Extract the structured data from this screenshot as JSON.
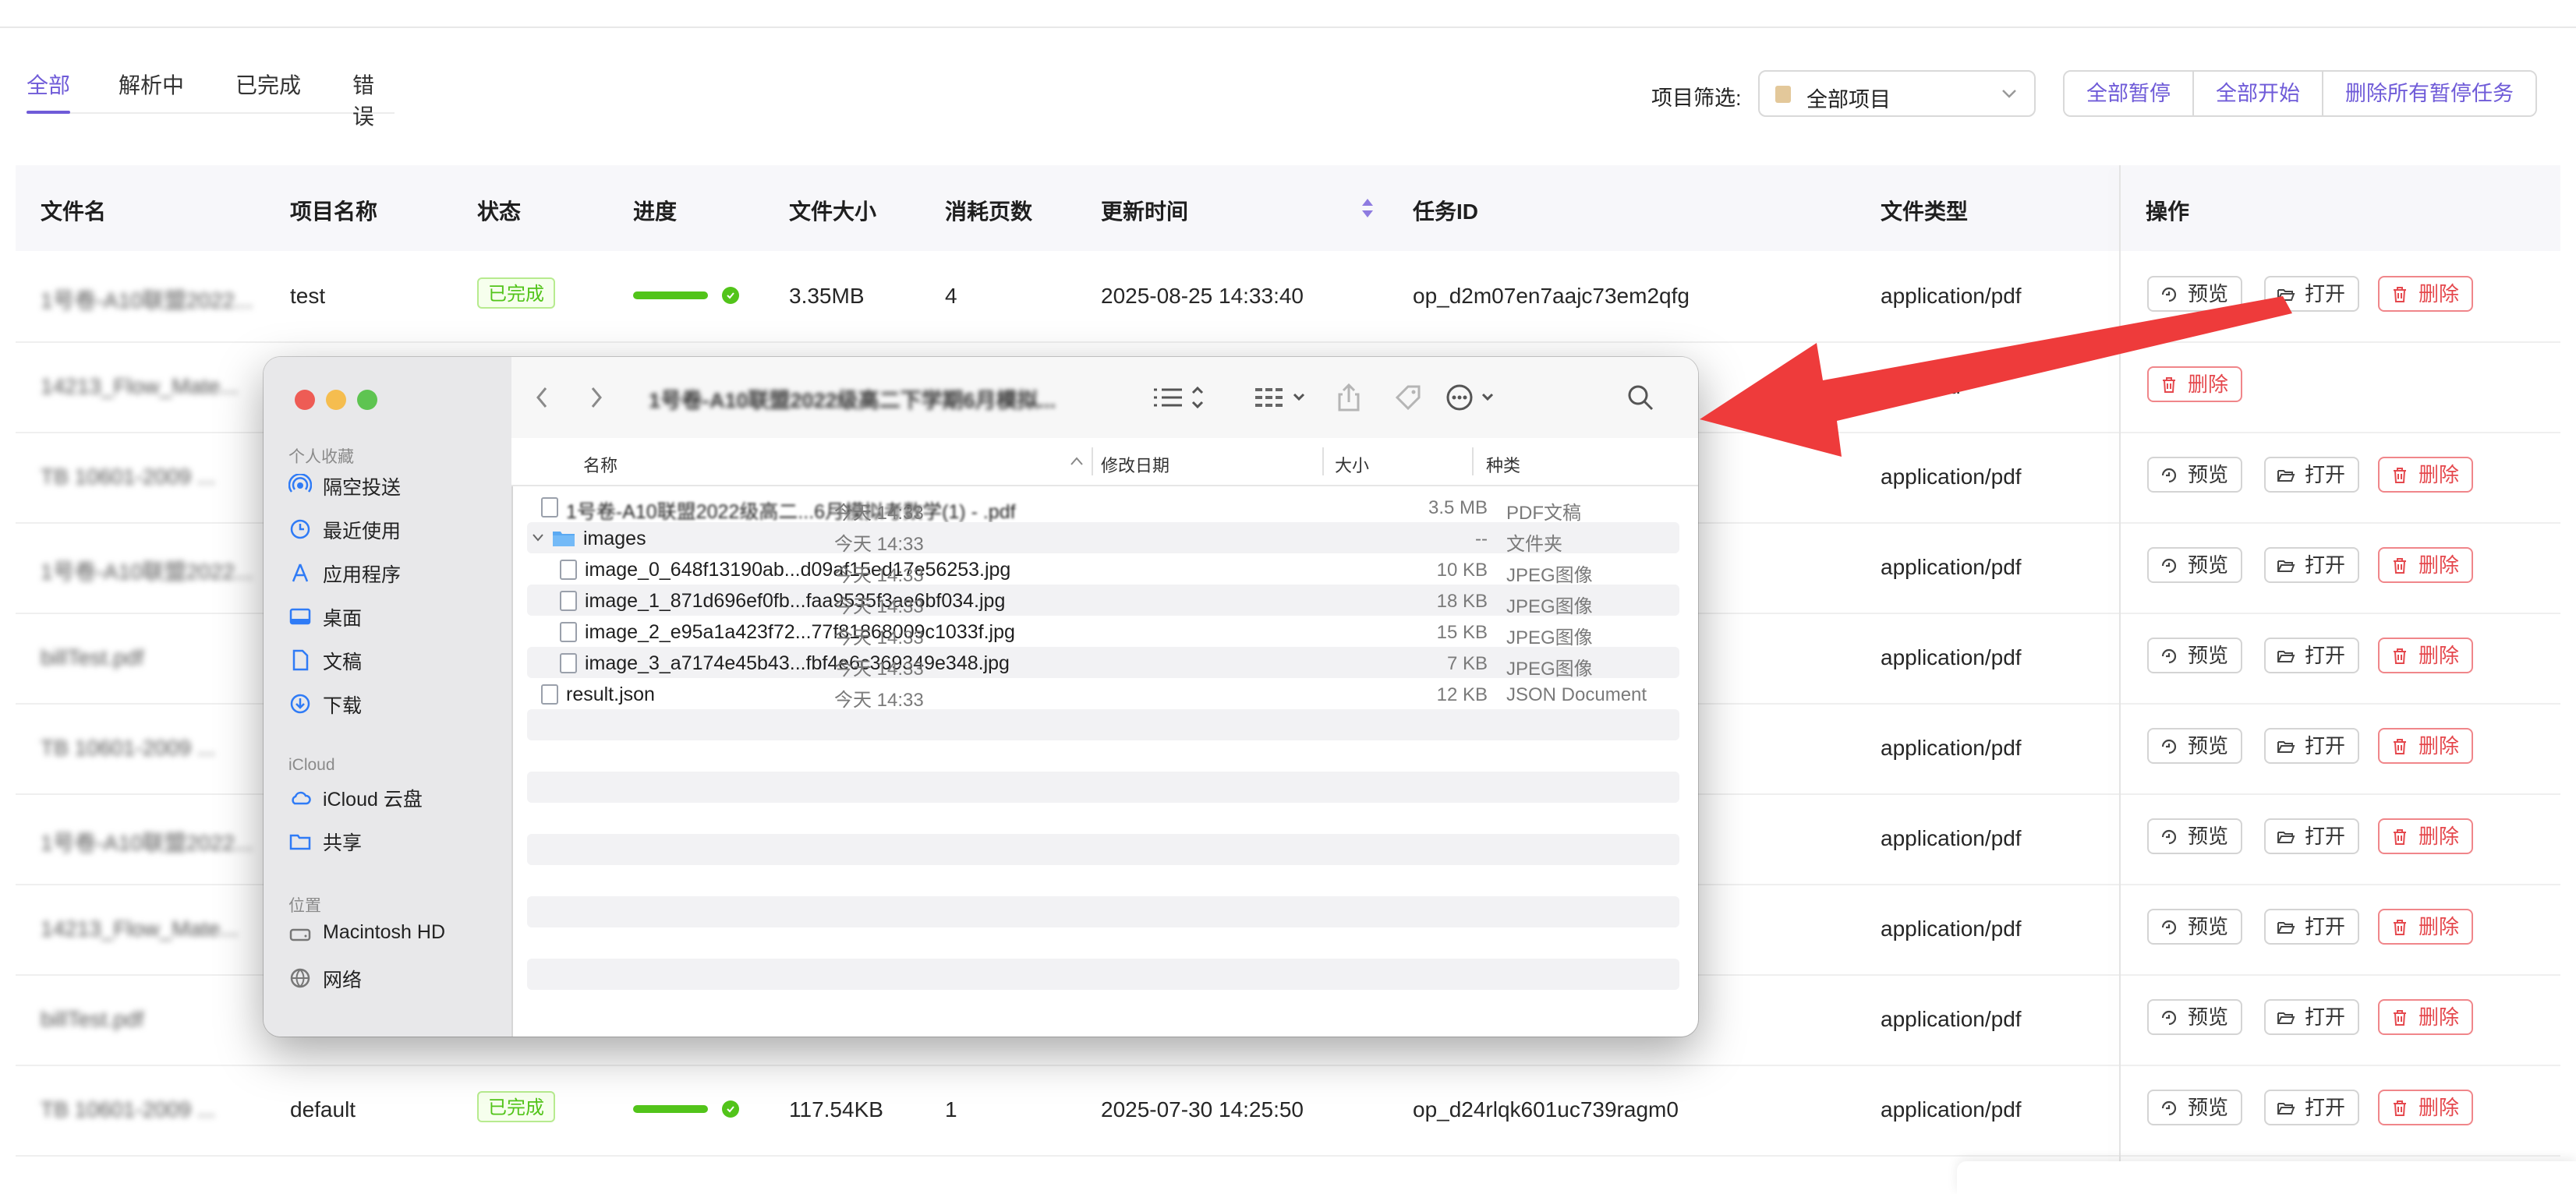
{
  "tabs": [
    {
      "label": "全部",
      "active": true
    },
    {
      "label": "解析中",
      "active": false
    },
    {
      "label": "已完成",
      "active": false
    },
    {
      "label": "错误",
      "active": false
    }
  ],
  "filter": {
    "label": "项目筛选:",
    "value": "全部项目"
  },
  "bulk_actions": [
    "全部暂停",
    "全部开始",
    "删除所有暂停任务"
  ],
  "table": {
    "columns": [
      "文件名",
      "项目名称",
      "状态",
      "进度",
      "文件大小",
      "消耗页数",
      "更新时间",
      "任务ID",
      "文件类型",
      "操作"
    ],
    "rows": [
      {
        "filename": "1号卷-A10联盟2022...",
        "project": "test",
        "status": "已完成",
        "progress": 1.0,
        "size": "3.35MB",
        "pages": "4",
        "updated": "2025-08-25 14:33:40",
        "task_id": "op_d2m07en7aajc73em2qfg",
        "type": "application/pdf"
      },
      {
        "filename": "14213_Flow_Mate...",
        "project": "",
        "status": "",
        "progress": null,
        "size": "",
        "pages": "",
        "updated": "",
        "task_id": "",
        "type": "applicati"
      },
      {
        "filename": "TB 10601-2009 ...",
        "project": "",
        "status": "",
        "progress": null,
        "size": "",
        "pages": "",
        "updated": "",
        "task_id": "",
        "type": "application/pdf"
      },
      {
        "filename": "1号卷-A10联盟2022...",
        "project": "",
        "status": "",
        "progress": null,
        "size": "",
        "pages": "",
        "updated": "",
        "task_id": "",
        "type": "application/pdf"
      },
      {
        "filename": "billTest.pdf",
        "project": "",
        "status": "",
        "progress": null,
        "size": "",
        "pages": "",
        "updated": "",
        "task_id": "",
        "type": "application/pdf"
      },
      {
        "filename": "TB 10601-2009 ...",
        "project": "",
        "status": "",
        "progress": null,
        "size": "",
        "pages": "",
        "updated": "",
        "task_id": "",
        "type": "application/pdf"
      },
      {
        "filename": "1号卷-A10联盟2022...",
        "project": "",
        "status": "",
        "progress": null,
        "size": "",
        "pages": "",
        "updated": "",
        "task_id": "",
        "type": "application/pdf"
      },
      {
        "filename": "14213_Flow_Mate...",
        "project": "",
        "status": "",
        "progress": null,
        "size": "",
        "pages": "",
        "updated": "",
        "task_id": "",
        "type": "application/pdf"
      },
      {
        "filename": "billTest.pdf",
        "project": "",
        "status": "",
        "progress": null,
        "size": "",
        "pages": "",
        "updated": "",
        "task_id": "",
        "type": "application/pdf"
      },
      {
        "filename": "TB 10601-2009 ...",
        "project": "default",
        "status": "已完成",
        "progress": 1.0,
        "size": "117.54KB",
        "pages": "1",
        "updated": "2025-07-30 14:25:50",
        "task_id": "op_d24rlqk601uc739ragm0",
        "type": "application/pdf"
      }
    ],
    "row_actions": {
      "preview": "预览",
      "open": "打开",
      "delete": "删除"
    }
  },
  "finder": {
    "title": "1号卷-A10联盟2022级高二下学期6月模拟...",
    "sidebar": {
      "favorites_header": "个人收藏",
      "favorites": [
        "隔空投送",
        "最近使用",
        "应用程序",
        "桌面",
        "文稿",
        "下载"
      ],
      "icloud_header": "iCloud",
      "icloud": [
        "iCloud 云盘",
        "共享"
      ],
      "locations_header": "位置",
      "locations": [
        "Macintosh HD",
        "网络"
      ]
    },
    "columns": {
      "name": "名称",
      "date": "修改日期",
      "size": "大小",
      "kind": "种类"
    },
    "files": [
      {
        "name": "1号卷-A10联盟2022级高二...6月模拟考数学(1) - .pdf",
        "date": "今天 14:33",
        "size": "3.5 MB",
        "kind": "PDF文稿",
        "icon": "pdf-file-icon"
      },
      {
        "name": "images",
        "date": "今天 14:33",
        "size": "--",
        "kind": "文件夹",
        "icon": "folder-icon"
      },
      {
        "name": "image_0_648f13190ab...d09af15ed17e56253.jpg",
        "date": "今天 14:33",
        "size": "10 KB",
        "kind": "JPEG图像",
        "icon": "image-file-icon"
      },
      {
        "name": "image_1_871d696ef0fb...faa9535f3ae6bf034.jpg",
        "date": "今天 14:33",
        "size": "18 KB",
        "kind": "JPEG图像",
        "icon": "image-file-icon"
      },
      {
        "name": "image_2_e95a1a423f72...77f81868009c1033f.jpg",
        "date": "今天 14:33",
        "size": "15 KB",
        "kind": "JPEG图像",
        "icon": "image-file-icon"
      },
      {
        "name": "image_3_a7174e45b43...fbf4e6c369349e348.jpg",
        "date": "今天 14:33",
        "size": "7 KB",
        "kind": "JPEG图像",
        "icon": "image-file-icon"
      },
      {
        "name": "result.json",
        "date": "今天 14:33",
        "size": "12 KB",
        "kind": "JSON Document",
        "icon": "json-file-icon"
      }
    ]
  },
  "colors": {
    "accent": "#6f5bd8",
    "success": "#52c41a",
    "danger": "#e5484d",
    "arrow": "#ee3b3b"
  }
}
